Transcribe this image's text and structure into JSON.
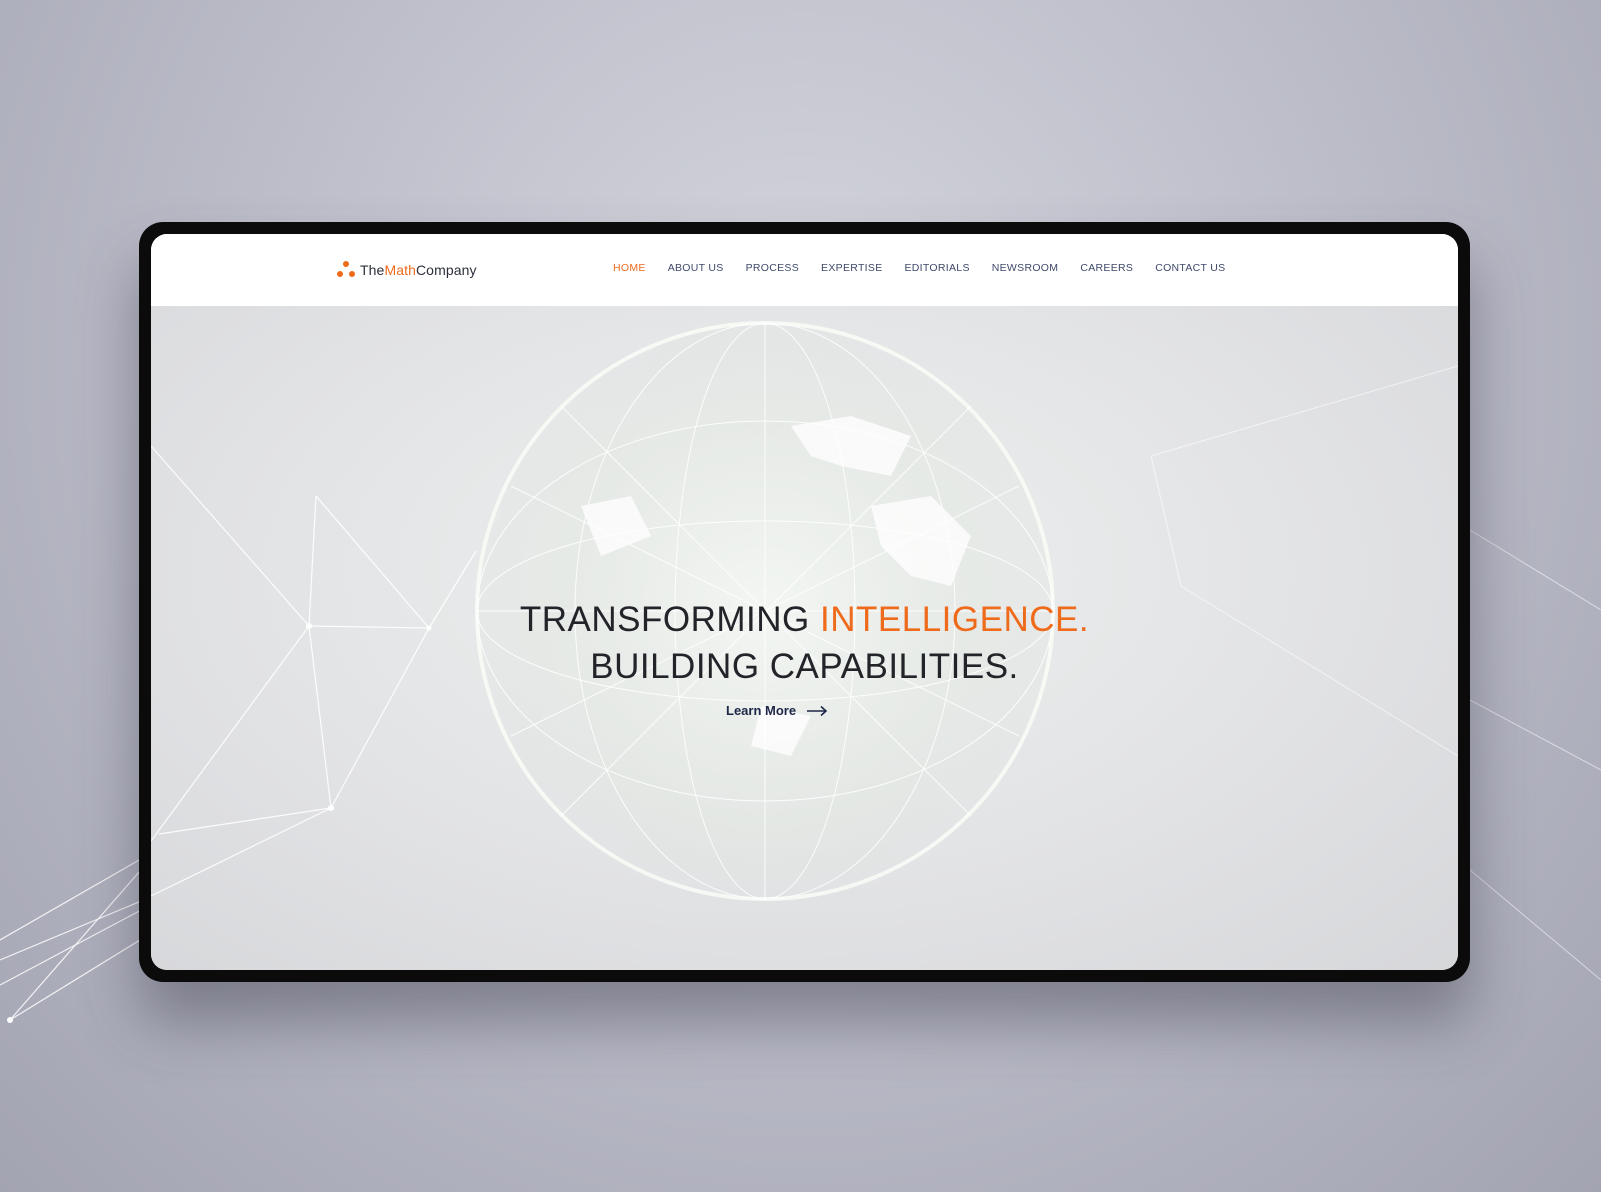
{
  "brand": {
    "name_part1": "The",
    "name_part2": "Math",
    "name_part3": "Company",
    "accent_color": "#ef6b1c"
  },
  "nav": {
    "items": [
      {
        "label": "HOME",
        "active": true
      },
      {
        "label": "ABOUT US",
        "active": false
      },
      {
        "label": "PROCESS",
        "active": false
      },
      {
        "label": "EXPERTISE",
        "active": false
      },
      {
        "label": "EDITORIALS",
        "active": false
      },
      {
        "label": "NEWSROOM",
        "active": false
      },
      {
        "label": "CAREERS",
        "active": false
      },
      {
        "label": "CONTACT US",
        "active": false
      }
    ]
  },
  "hero": {
    "line1_part1": "TRANSFORMING ",
    "line1_part2": "INTELLIGENCE.",
    "line2": "BUILDING CAPABILITIES.",
    "cta_label": "Learn More",
    "cta_icon": "arrow-right-icon"
  },
  "colors": {
    "nav_text": "#3f4a6a",
    "title_text": "#222429",
    "cta_text": "#1d2748"
  }
}
